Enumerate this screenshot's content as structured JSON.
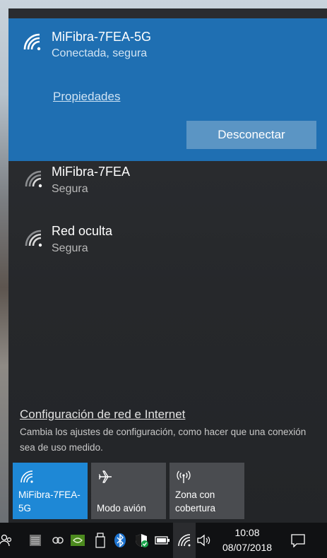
{
  "networks": {
    "connected": {
      "name": "MiFibra-7FEA-5G",
      "status": "Conectada, segura",
      "properties_label": "Propiedades",
      "disconnect_label": "Desconectar"
    },
    "others": [
      {
        "name": "MiFibra-7FEA",
        "status": "Segura"
      },
      {
        "name": "Red oculta",
        "status": "Segura"
      }
    ]
  },
  "settings": {
    "link_label": "Configuración de red e Internet",
    "description": "Cambia los ajustes de configuración, como hacer que una conexión sea de uso medido."
  },
  "quick_actions": [
    {
      "label": "MiFibra-7FEA-5G",
      "icon": "wifi-icon",
      "active": true
    },
    {
      "label": "Modo avión",
      "icon": "airplane-icon",
      "active": false
    },
    {
      "label": "Zona con cobertura",
      "icon": "hotspot-icon",
      "active": false
    }
  ],
  "taskbar": {
    "time": "10:08",
    "date": "08/07/2018"
  },
  "colors": {
    "connected_bg": "#1f6fb2",
    "active_tile": "#1e88d6",
    "inactive_tile": "#4a4c50",
    "taskbar": "#101113"
  }
}
